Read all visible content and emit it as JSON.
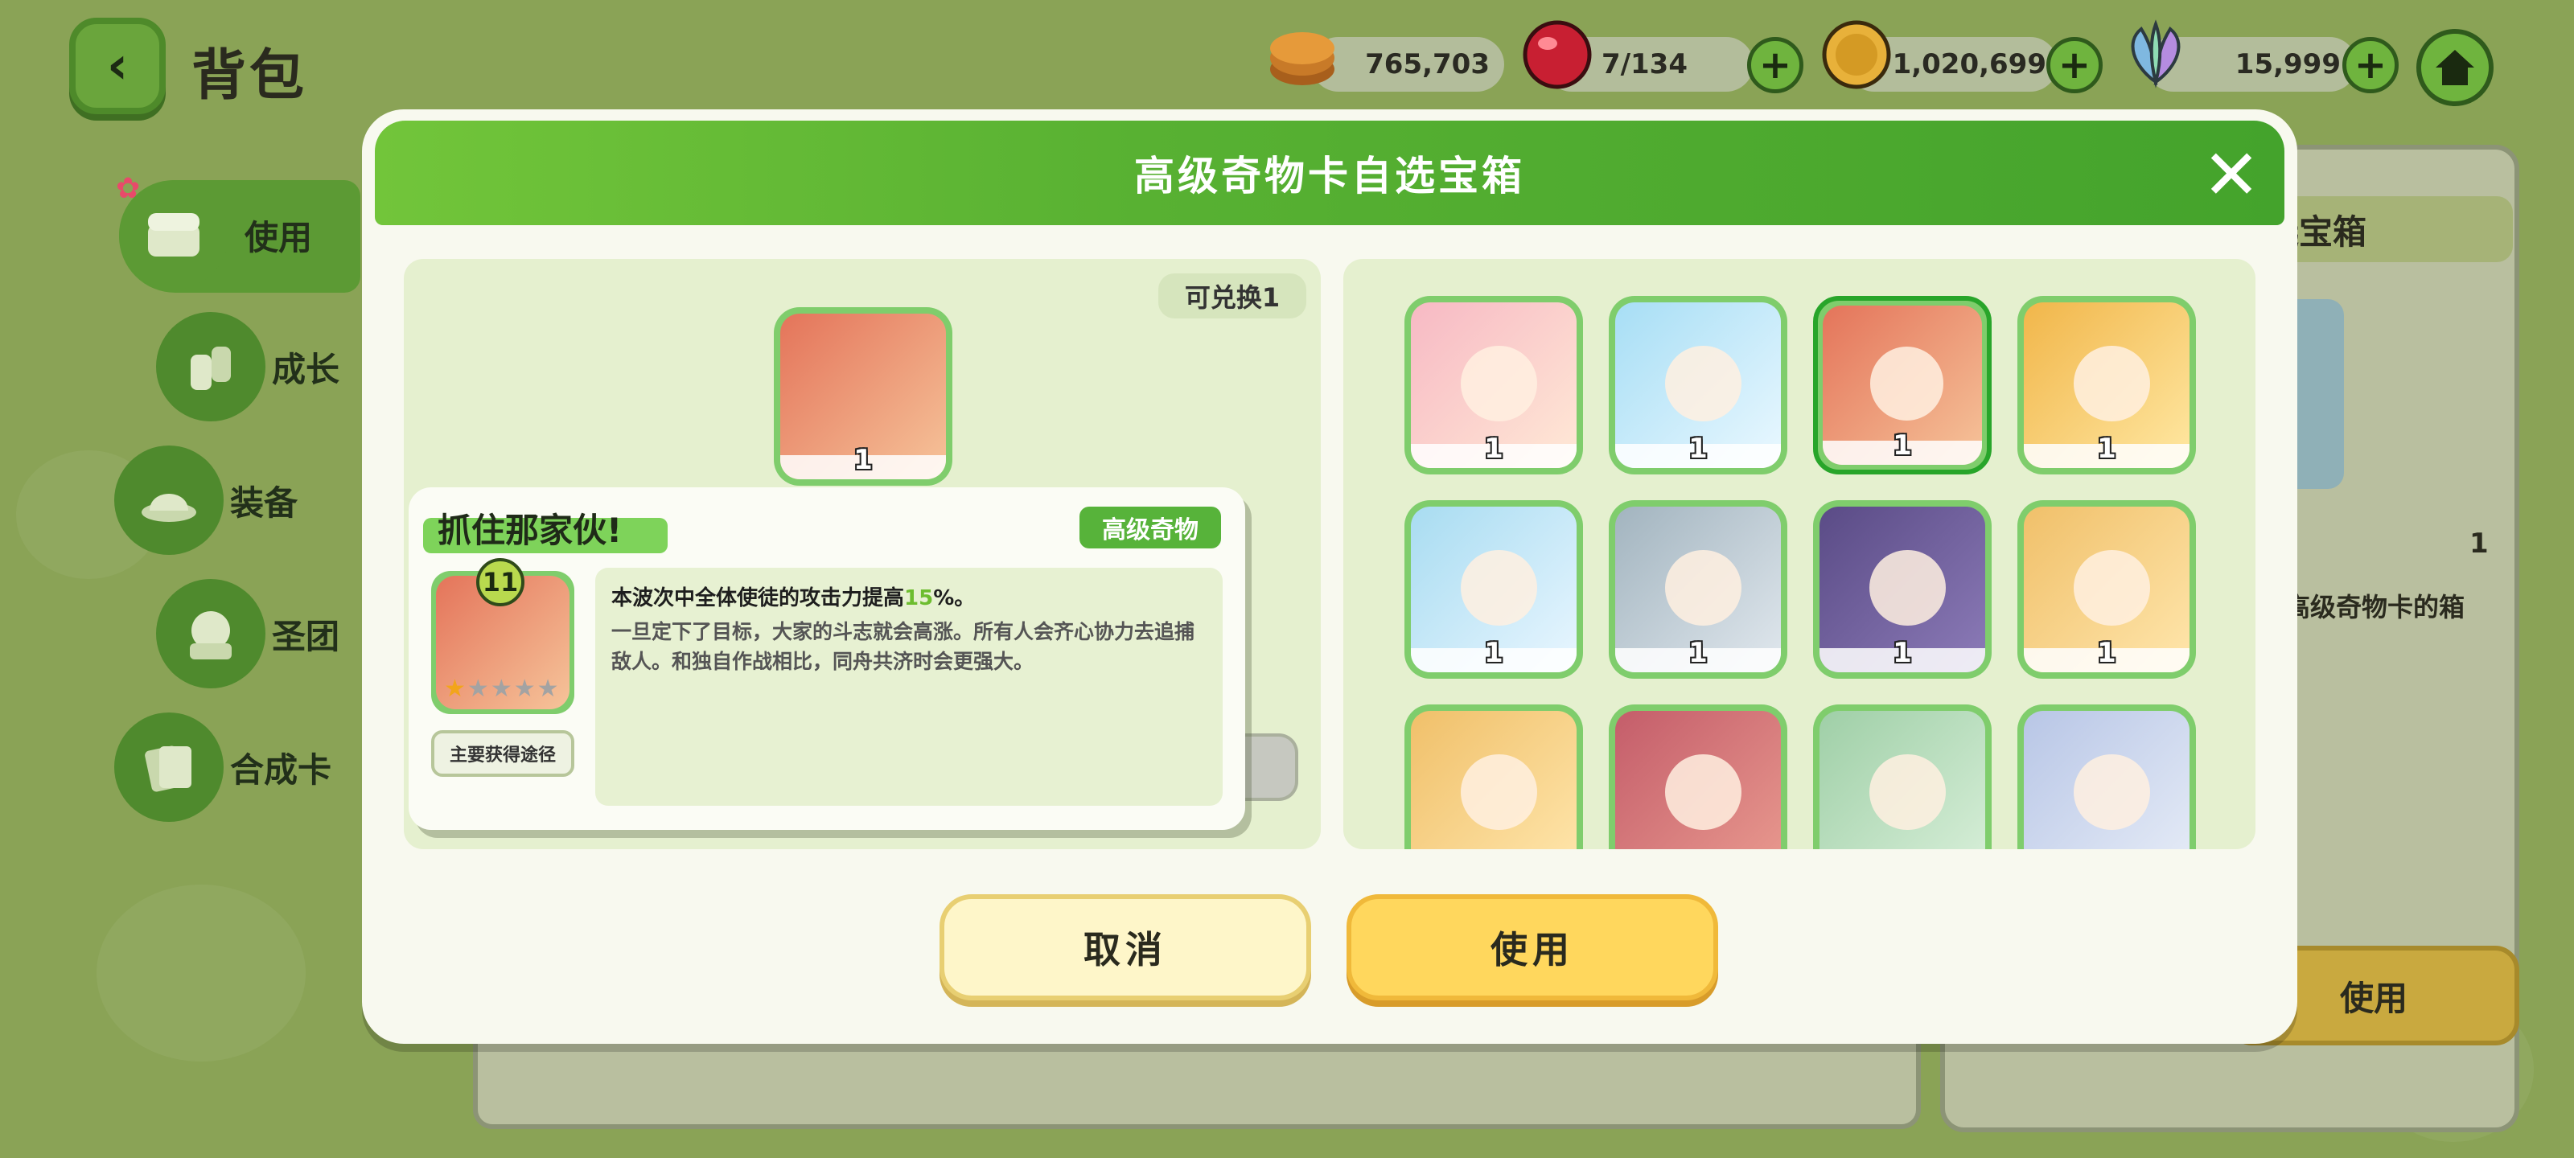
{
  "header": {
    "back_icon": "chevron-left-icon",
    "title": "背包"
  },
  "currencies": [
    {
      "icon": "pancake-icon",
      "value": "765,703",
      "color": "#c87a28",
      "has_plus": false
    },
    {
      "icon": "red-gem-icon",
      "value": "7/134",
      "color": "#d42b3a",
      "has_plus": true
    },
    {
      "icon": "gold-coin-icon",
      "value": "1,020,699",
      "color": "#d9a22a",
      "has_plus": true
    },
    {
      "icon": "crystal-leaf-icon",
      "value": "15,999",
      "color": "#7fb8e0",
      "has_plus": true
    }
  ],
  "home_icon": "home-icon",
  "sidebar": {
    "items": [
      {
        "label": "使用",
        "icon": "chest-icon",
        "active": true
      },
      {
        "label": "成长",
        "icon": "bottle-icon"
      },
      {
        "label": "装备",
        "icon": "hat-icon"
      },
      {
        "label": "圣团",
        "icon": "emblem-icon"
      },
      {
        "label": "合成卡",
        "icon": "card-icon"
      }
    ]
  },
  "background_panel": {
    "title": "选宝箱",
    "count": "1",
    "desc": "高级奇物卡的箱",
    "use_label": "使用"
  },
  "modal": {
    "title": "高级奇物卡自选宝箱",
    "redeem_label": "可兑换1",
    "selected_count": "1",
    "cards": [
      {
        "count": "1",
        "theme": "red-pill",
        "colors": [
          "#f7b9c4",
          "#ffe9d6"
        ]
      },
      {
        "count": "1",
        "theme": "blue-pill",
        "colors": [
          "#a7def5",
          "#eaf8ff"
        ]
      },
      {
        "count": "1",
        "theme": "chase",
        "colors": [
          "#e4745a",
          "#f6c49a"
        ],
        "selected": true
      },
      {
        "count": "1",
        "theme": "blonde-leader",
        "colors": [
          "#f1b64a",
          "#ffe8a3"
        ]
      },
      {
        "count": "1",
        "theme": "bear-girl",
        "colors": [
          "#a8dcf1",
          "#e9f6ff"
        ]
      },
      {
        "count": "1",
        "theme": "gold-coin",
        "colors": [
          "#a2b4bf",
          "#e1e8ee"
        ]
      },
      {
        "count": "1",
        "theme": "silver-hair",
        "colors": [
          "#5a4b86",
          "#8c7bb8"
        ]
      },
      {
        "count": "1",
        "theme": "braid-girl",
        "colors": [
          "#f0c06a",
          "#ffe6ac"
        ]
      },
      {
        "count": "",
        "theme": "sword-girl",
        "colors": [
          "#f0c06a",
          "#ffe6ac"
        ]
      },
      {
        "count": "",
        "theme": "red-hair",
        "colors": [
          "#c45d6a",
          "#e99a8f"
        ]
      },
      {
        "count": "",
        "theme": "shadow-pair",
        "colors": [
          "#9fcfa7",
          "#d8efd9"
        ]
      },
      {
        "count": "",
        "theme": "dark-hair",
        "colors": [
          "#b8c6e6",
          "#e6ecf7"
        ]
      }
    ],
    "tooltip": {
      "name": "抓住那家伙!",
      "rarity": "高级奇物",
      "level": "11",
      "stars_filled": 1,
      "stars_total": 5,
      "source_label": "主要获得途径",
      "desc_pre": "本波次中全体使徒的攻击力提高",
      "desc_value": "15",
      "desc_post": "%。",
      "flavor": "一旦定下了目标，大家的斗志就会高涨。所有人会齐心协力去追捕敌人。和独自作战相比，同舟共济时会更强大。"
    },
    "cancel_label": "取消",
    "use_label": "使用"
  }
}
